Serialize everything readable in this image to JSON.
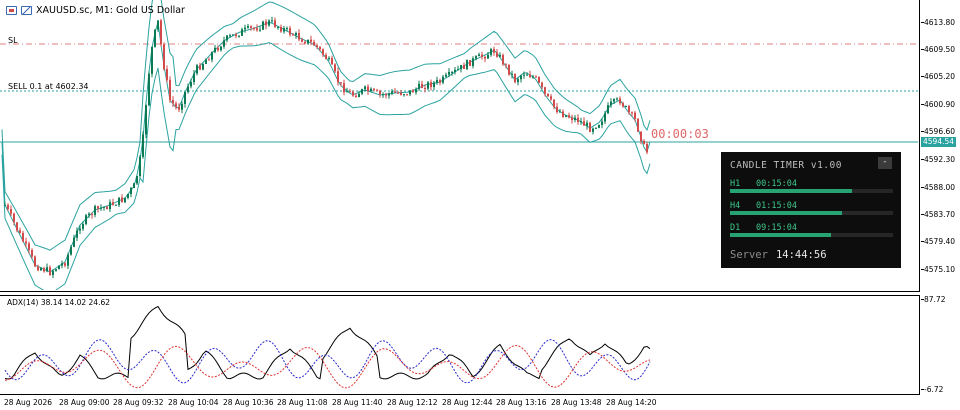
{
  "chart": {
    "symbol": "XAUUSD.sc, M1:  Gold US Dollar",
    "sl_label": "SL",
    "order_label": "SELL 0.1 at 4602.34",
    "current_price": "4594.54",
    "countdown": "00:00:03",
    "price_ticks": [
      "4613.80",
      "4609.50",
      "4605.20",
      "4600.90",
      "4596.60",
      "4592.30",
      "4588.00",
      "4583.70",
      "4579.40",
      "4575.10"
    ],
    "time_ticks": [
      "28 Aug 2026",
      "28 Aug 09:00",
      "28 Aug 09:32",
      "28 Aug 10:04",
      "28 Aug 10:36",
      "28 Aug 11:08",
      "28 Aug 11:40",
      "28 Aug 12:12",
      "28 Aug 12:44",
      "28 Aug 13:16",
      "28 Aug 13:48",
      "28 Aug 14:20"
    ],
    "colors": {
      "bollinger": "#2aa3a0",
      "bull": "#0b7a52",
      "bear": "#d24a4a",
      "sl_line": "#e08080",
      "order_line": "#2aa3a0"
    }
  },
  "adx": {
    "label": "ADX(14) 38.14 14.02 24.62",
    "max": "87.72",
    "min": "-6.72",
    "colors": {
      "adx": "#000000",
      "plus_di": "#2a2ad0",
      "minus_di": "#e03030"
    }
  },
  "timer": {
    "title": "CANDLE TIMER v1.00",
    "minimize": "-",
    "rows": [
      {
        "tf": "H1",
        "time": "00:15:04",
        "progress": 0.75
      },
      {
        "tf": "H4",
        "time": "01:15:04",
        "progress": 0.69
      },
      {
        "tf": "D1",
        "time": "09:15:04",
        "progress": 0.62
      }
    ],
    "server_label": "Server",
    "server_time": "14:44:56"
  }
}
